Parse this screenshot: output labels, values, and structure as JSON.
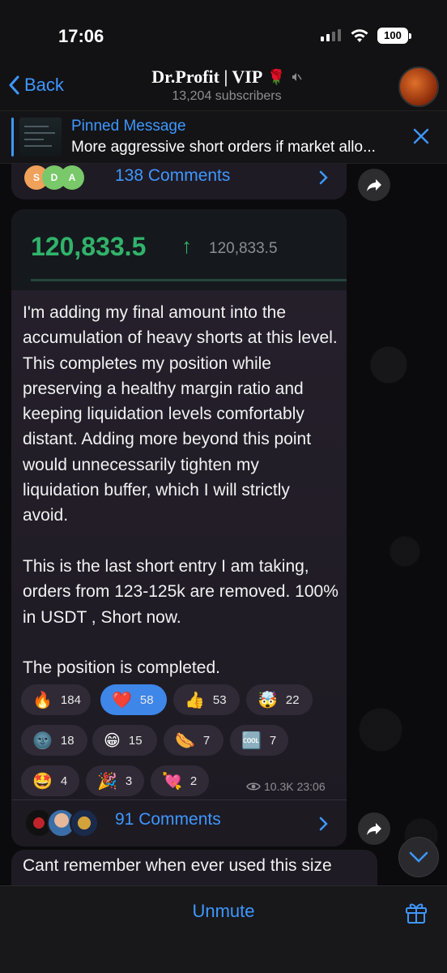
{
  "status": {
    "time": "17:06",
    "battery": "100"
  },
  "header": {
    "back_label": "Back",
    "title": "Dr.Profit | VIP",
    "rose": "🌹",
    "subscribers": "13,204 subscribers"
  },
  "pinned": {
    "label": "Pinned Message",
    "text": "More aggressive short orders if market allo..."
  },
  "prev_message": {
    "avatars": [
      "S",
      "D",
      "A"
    ],
    "comments": "138 Comments"
  },
  "message": {
    "price_main": "120,833.5",
    "price_arrow": "↑",
    "price_sub": "120,833.5",
    "text": "I'm adding my final amount into the accumulation of heavy shorts at this level. This completes my position while preserving a healthy margin ratio and keeping liquidation levels comfortably distant. Adding more beyond this point would unnecessarily tighten my liquidation buffer, which I will strictly avoid.\n\nThis is the last short entry I am taking, orders from 123-125k are removed. 100% in USDT , Short now.\n\nThe position is completed.",
    "reactions": [
      {
        "emoji": "🔥",
        "count": "184",
        "selected": false
      },
      {
        "emoji": "❤️",
        "count": "58",
        "selected": true
      },
      {
        "emoji": "👍",
        "count": "53",
        "selected": false
      },
      {
        "emoji": "🤯",
        "count": "22",
        "selected": false
      },
      {
        "emoji": "🌚",
        "count": "18",
        "selected": false
      },
      {
        "emoji": "😁",
        "count": "15",
        "selected": false
      },
      {
        "emoji": "🌭",
        "count": "7",
        "selected": false
      },
      {
        "emoji": "🆒",
        "count": "7",
        "selected": false
      },
      {
        "emoji": "🤩",
        "count": "4",
        "selected": false
      },
      {
        "emoji": "🎉",
        "count": "3",
        "selected": false
      },
      {
        "emoji": "💘",
        "count": "2",
        "selected": false
      }
    ],
    "views": "10.3K",
    "time": "23:06",
    "comments": "91 Comments"
  },
  "next_message": {
    "text": "Cant remember when ever used this size"
  },
  "bottom": {
    "unmute_label": "Unmute"
  },
  "colors": {
    "accent": "#3e97ff",
    "price_green": "#31b36b",
    "bubble": "#26202c"
  }
}
